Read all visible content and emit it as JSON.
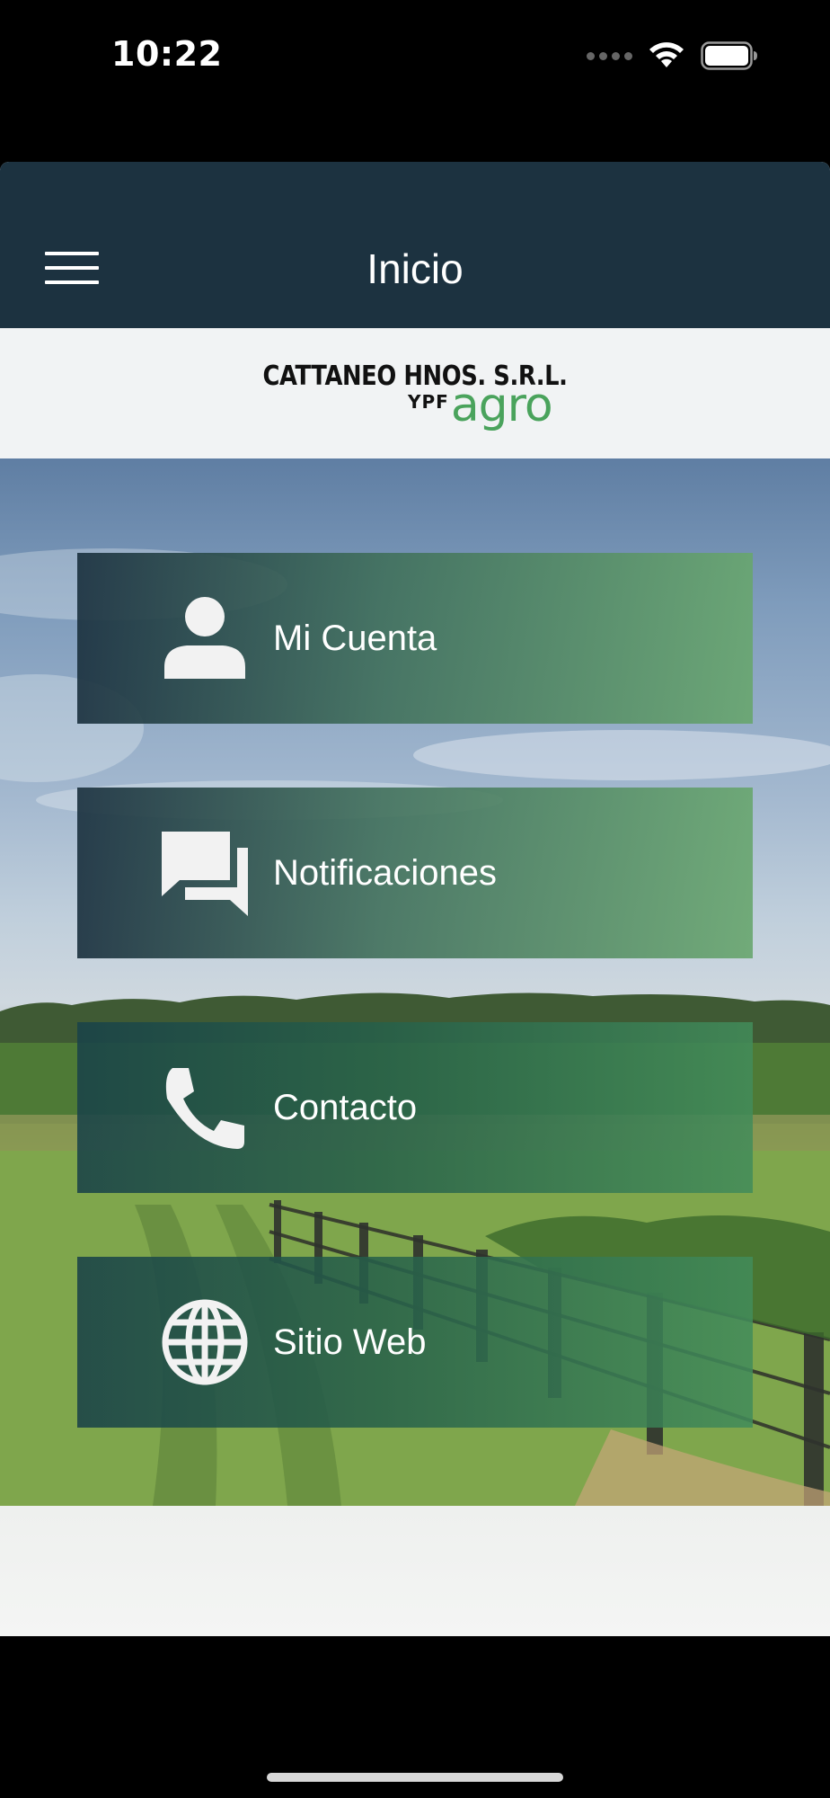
{
  "status_bar": {
    "time": "10:22"
  },
  "nav": {
    "title": "Inicio",
    "menu_icon": "hamburger-menu-icon"
  },
  "logo": {
    "company": "CATTANEO HNOS. S.R.L.",
    "brand_prefix": "YPF",
    "brand_suffix": "agro",
    "brand_color": "#4aa35c"
  },
  "menu": {
    "items": [
      {
        "label": "Mi Cuenta",
        "icon": "user-icon"
      },
      {
        "label": "Notificaciones",
        "icon": "chat-bubbles-icon"
      },
      {
        "label": "Contacto",
        "icon": "phone-icon"
      },
      {
        "label": "Sitio Web",
        "icon": "globe-icon"
      }
    ]
  },
  "colors": {
    "nav_background": "#1c3240",
    "button_gradient_start": "#1c3240",
    "button_gradient_end": "#68a66e"
  }
}
